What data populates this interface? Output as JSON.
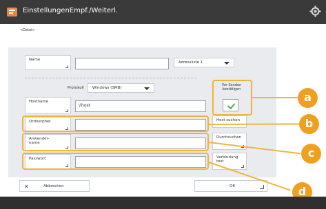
{
  "window": {
    "title": "EinstellungenEmpf./Weiterl."
  },
  "breadcrumb": "<Datei>",
  "form": {
    "name_label": "Name",
    "address_list": "Adressliste 1",
    "protocol_label": "Protokoll",
    "protocol_value": "Windows (SMB)",
    "confirm_label": "Vor Senden bestätigen",
    "hostname_label": "Hostname",
    "hostname_value": "\\\\host",
    "folder_path_label": "Ordnerpfad",
    "username_label": "Anwender-\nname",
    "password_label": "Passwort",
    "host_search": "Host suchen",
    "browse": "Durchsuchen",
    "connection_test": "Verbindung\ntest"
  },
  "footer": {
    "cancel": "Abbrechen",
    "ok": "OK"
  },
  "callouts": [
    "a",
    "b",
    "c",
    "d"
  ],
  "colors": {
    "accent": "#f0b43c",
    "badge": "#f0a020",
    "titlebar": "#3a3a3a"
  }
}
